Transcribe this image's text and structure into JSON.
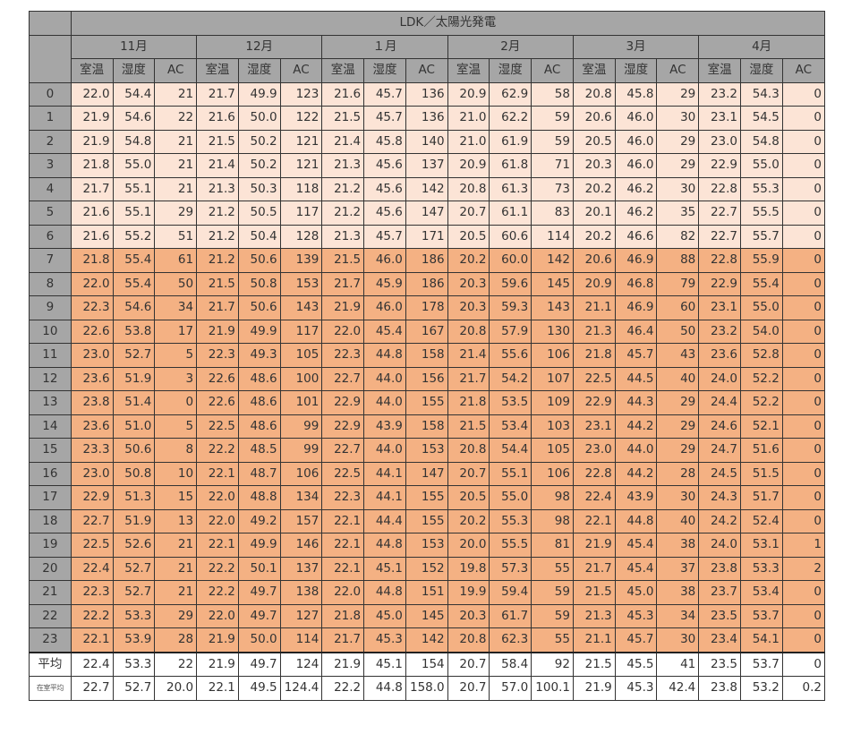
{
  "title": "LDK／太陽光発電",
  "months": [
    "11月",
    "12月",
    "１月",
    "2月",
    "3月",
    "4月"
  ],
  "subheaders": [
    "室温",
    "湿度",
    "AC"
  ],
  "rows": [
    {
      "hour": "0",
      "cells": [
        "22.0",
        "54.4",
        "21",
        "21.7",
        "49.9",
        "123",
        "21.6",
        "45.7",
        "136",
        "20.9",
        "62.9",
        "58",
        "20.8",
        "45.8",
        "29",
        "23.2",
        "54.3",
        "0"
      ]
    },
    {
      "hour": "1",
      "cells": [
        "21.9",
        "54.6",
        "22",
        "21.6",
        "50.0",
        "122",
        "21.5",
        "45.7",
        "136",
        "21.0",
        "62.2",
        "59",
        "20.6",
        "46.0",
        "30",
        "23.1",
        "54.5",
        "0"
      ]
    },
    {
      "hour": "2",
      "cells": [
        "21.9",
        "54.8",
        "21",
        "21.5",
        "50.2",
        "121",
        "21.4",
        "45.8",
        "140",
        "21.0",
        "61.9",
        "59",
        "20.5",
        "46.0",
        "29",
        "23.0",
        "54.8",
        "0"
      ]
    },
    {
      "hour": "3",
      "cells": [
        "21.8",
        "55.0",
        "21",
        "21.4",
        "50.2",
        "121",
        "21.3",
        "45.6",
        "137",
        "20.9",
        "61.8",
        "71",
        "20.3",
        "46.0",
        "29",
        "22.9",
        "55.0",
        "0"
      ]
    },
    {
      "hour": "4",
      "cells": [
        "21.7",
        "55.1",
        "21",
        "21.3",
        "50.3",
        "118",
        "21.2",
        "45.6",
        "142",
        "20.8",
        "61.3",
        "73",
        "20.2",
        "46.2",
        "30",
        "22.8",
        "55.3",
        "0"
      ]
    },
    {
      "hour": "5",
      "cells": [
        "21.6",
        "55.1",
        "29",
        "21.2",
        "50.5",
        "117",
        "21.2",
        "45.6",
        "147",
        "20.7",
        "61.1",
        "83",
        "20.1",
        "46.2",
        "35",
        "22.7",
        "55.5",
        "0"
      ]
    },
    {
      "hour": "6",
      "cells": [
        "21.6",
        "55.2",
        "51",
        "21.2",
        "50.4",
        "128",
        "21.3",
        "45.7",
        "171",
        "20.5",
        "60.6",
        "114",
        "20.2",
        "46.6",
        "82",
        "22.7",
        "55.7",
        "0"
      ]
    },
    {
      "hour": "7",
      "cells": [
        "21.8",
        "55.4",
        "61",
        "21.2",
        "50.6",
        "139",
        "21.5",
        "46.0",
        "186",
        "20.2",
        "60.0",
        "142",
        "20.6",
        "46.9",
        "88",
        "22.8",
        "55.9",
        "0"
      ]
    },
    {
      "hour": "8",
      "cells": [
        "22.0",
        "55.4",
        "50",
        "21.5",
        "50.8",
        "153",
        "21.7",
        "45.9",
        "186",
        "20.3",
        "59.6",
        "145",
        "20.9",
        "46.8",
        "79",
        "22.9",
        "55.4",
        "0"
      ]
    },
    {
      "hour": "9",
      "cells": [
        "22.3",
        "54.6",
        "34",
        "21.7",
        "50.6",
        "143",
        "21.9",
        "46.0",
        "178",
        "20.3",
        "59.3",
        "143",
        "21.1",
        "46.9",
        "60",
        "23.1",
        "55.0",
        "0"
      ]
    },
    {
      "hour": "10",
      "cells": [
        "22.6",
        "53.8",
        "17",
        "21.9",
        "49.9",
        "117",
        "22.0",
        "45.4",
        "167",
        "20.8",
        "57.9",
        "130",
        "21.3",
        "46.4",
        "50",
        "23.2",
        "54.0",
        "0"
      ]
    },
    {
      "hour": "11",
      "cells": [
        "23.0",
        "52.7",
        "5",
        "22.3",
        "49.3",
        "105",
        "22.3",
        "44.8",
        "158",
        "21.4",
        "55.6",
        "106",
        "21.8",
        "45.7",
        "43",
        "23.6",
        "52.8",
        "0"
      ]
    },
    {
      "hour": "12",
      "cells": [
        "23.6",
        "51.9",
        "3",
        "22.6",
        "48.6",
        "100",
        "22.7",
        "44.0",
        "156",
        "21.7",
        "54.2",
        "107",
        "22.5",
        "44.5",
        "40",
        "24.0",
        "52.2",
        "0"
      ]
    },
    {
      "hour": "13",
      "cells": [
        "23.8",
        "51.4",
        "0",
        "22.6",
        "48.6",
        "101",
        "22.9",
        "44.0",
        "155",
        "21.8",
        "53.5",
        "109",
        "22.9",
        "44.3",
        "29",
        "24.4",
        "52.2",
        "0"
      ]
    },
    {
      "hour": "14",
      "cells": [
        "23.6",
        "51.0",
        "5",
        "22.5",
        "48.6",
        "99",
        "22.9",
        "43.9",
        "158",
        "21.5",
        "53.4",
        "103",
        "23.1",
        "44.2",
        "29",
        "24.6",
        "52.1",
        "0"
      ]
    },
    {
      "hour": "15",
      "cells": [
        "23.3",
        "50.6",
        "8",
        "22.2",
        "48.5",
        "99",
        "22.7",
        "44.0",
        "153",
        "20.8",
        "54.4",
        "105",
        "23.0",
        "44.0",
        "29",
        "24.7",
        "51.6",
        "0"
      ]
    },
    {
      "hour": "16",
      "cells": [
        "23.0",
        "50.8",
        "10",
        "22.1",
        "48.7",
        "106",
        "22.5",
        "44.1",
        "147",
        "20.7",
        "55.1",
        "106",
        "22.8",
        "44.2",
        "28",
        "24.5",
        "51.5",
        "0"
      ]
    },
    {
      "hour": "17",
      "cells": [
        "22.9",
        "51.3",
        "15",
        "22.0",
        "48.8",
        "134",
        "22.3",
        "44.1",
        "155",
        "20.5",
        "55.0",
        "98",
        "22.4",
        "43.9",
        "30",
        "24.3",
        "51.7",
        "0"
      ]
    },
    {
      "hour": "18",
      "cells": [
        "22.7",
        "51.9",
        "13",
        "22.0",
        "49.2",
        "157",
        "22.1",
        "44.4",
        "155",
        "20.2",
        "55.3",
        "98",
        "22.1",
        "44.8",
        "40",
        "24.2",
        "52.4",
        "0"
      ]
    },
    {
      "hour": "19",
      "cells": [
        "22.5",
        "52.6",
        "21",
        "22.1",
        "49.9",
        "146",
        "22.1",
        "44.8",
        "153",
        "20.0",
        "55.5",
        "81",
        "21.9",
        "45.4",
        "38",
        "24.0",
        "53.1",
        "1"
      ]
    },
    {
      "hour": "20",
      "cells": [
        "22.4",
        "52.7",
        "21",
        "22.2",
        "50.1",
        "137",
        "22.1",
        "45.1",
        "152",
        "19.8",
        "57.3",
        "55",
        "21.7",
        "45.4",
        "37",
        "23.8",
        "53.3",
        "2"
      ]
    },
    {
      "hour": "21",
      "cells": [
        "22.3",
        "52.7",
        "21",
        "22.2",
        "49.7",
        "138",
        "22.0",
        "44.8",
        "151",
        "19.9",
        "59.4",
        "59",
        "21.5",
        "45.0",
        "38",
        "23.7",
        "53.4",
        "0"
      ]
    },
    {
      "hour": "22",
      "cells": [
        "22.2",
        "53.3",
        "29",
        "22.0",
        "49.7",
        "127",
        "21.8",
        "45.0",
        "145",
        "20.3",
        "61.7",
        "59",
        "21.3",
        "45.3",
        "34",
        "23.5",
        "53.7",
        "0"
      ]
    },
    {
      "hour": "23",
      "cells": [
        "22.1",
        "53.9",
        "28",
        "21.9",
        "50.0",
        "114",
        "21.7",
        "45.3",
        "142",
        "20.8",
        "62.3",
        "55",
        "21.1",
        "45.7",
        "30",
        "23.4",
        "54.1",
        "0"
      ]
    }
  ],
  "summary": [
    {
      "label": "平均",
      "cells": [
        "22.4",
        "53.3",
        "22",
        "21.9",
        "49.7",
        "124",
        "21.9",
        "45.1",
        "154",
        "20.7",
        "58.4",
        "92",
        "21.5",
        "45.5",
        "41",
        "23.5",
        "53.7",
        "0"
      ]
    },
    {
      "label": "在室平均",
      "cells": [
        "22.7",
        "52.7",
        "20.0",
        "22.1",
        "49.5",
        "124.4",
        "22.2",
        "44.8",
        "158.0",
        "20.7",
        "57.0",
        "100.1",
        "21.9",
        "45.3",
        "42.4",
        "23.8",
        "53.2",
        "0.2"
      ]
    }
  ],
  "colors": {
    "header_gray": "#a6a6a6",
    "night_fill": "#fce4d6",
    "day_fill": "#f4b183"
  }
}
